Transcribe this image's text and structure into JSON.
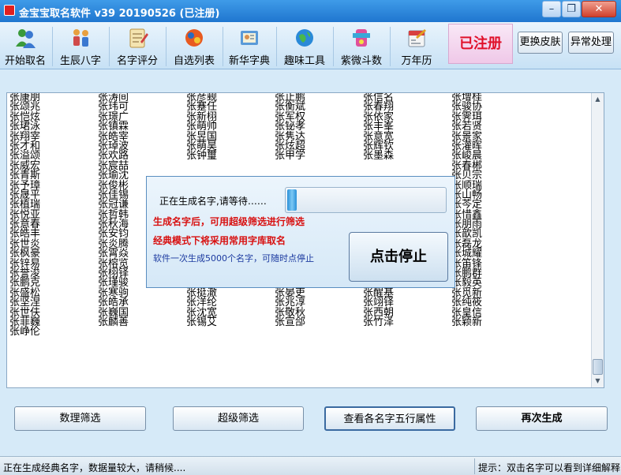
{
  "window": {
    "title": "金宝宝取名软件 v39 20190526 (已注册)",
    "minimize_glyph": "–",
    "restore_glyph": "❐",
    "close_glyph": "✕"
  },
  "toolbar": {
    "buttons": [
      {
        "label": "开始取名",
        "icon": "people-icon"
      },
      {
        "label": "生辰八字",
        "icon": "family-icon"
      },
      {
        "label": "名字评分",
        "icon": "notepad-icon"
      },
      {
        "label": "自选列表",
        "icon": "list-icon"
      },
      {
        "label": "新华字典",
        "icon": "dictionary-icon"
      },
      {
        "label": "趣味工具",
        "icon": "globe-icon"
      },
      {
        "label": "紫微斗数",
        "icon": "stars-icon"
      },
      {
        "label": "万年历",
        "icon": "calendar-icon"
      }
    ],
    "registered_label": "已注册",
    "skin_label": "更换皮肤",
    "exception_label": "异常处理"
  },
  "names": {
    "columns": [
      [
        "张康朋",
        "张颂兆",
        "张恺炫",
        "张珺泳",
        "张翔宰",
        "张才和",
        "张溢颂",
        "张威宏",
        "张青斯",
        "张予璋",
        "张晟平",
        "张植瑞",
        "张悦亚",
        "张意春",
        "张皓丰",
        "张世炎",
        "张枫豪",
        "张锌易",
        "张誉浚",
        "张鹏克",
        "张盛松",
        "张坚涅",
        "张世伕",
        "张菲巍",
        "张峥伦"
      ],
      [
        "张涛间",
        "张玮可",
        "张璟广",
        "张镇霖",
        "张皓宰",
        "张琸波",
        "张欢路",
        "张宸喆",
        "张瑜沈",
        "张俊彬",
        "张佳锡",
        "张冠谦",
        "张哲韩",
        "张秋海",
        "张安钧",
        "张炎腾",
        "张霄焱",
        "张榕览",
        "张栩铎",
        "张瑾骏",
        "张寒驹",
        "张皓承",
        "张巍国",
        "张麟善"
      ],
      [
        "张彦觋",
        "张蹇任",
        "张新栩",
        "张萌帅",
        "张昱国",
        "张萌昊",
        "张钟璽",
        "",
        "",
        "",
        "",
        "",
        "",
        "",
        "",
        "",
        "张猫峰",
        "张维军",
        "张景白",
        "张树禹",
        "张挺澈",
        "张洋纶",
        "张沈宽",
        "张锡艾"
      ],
      [
        "张止鹏",
        "张衡斌",
        "张军权",
        "张铋孝",
        "张隽达",
        "张炫超",
        "张甲学",
        "",
        "",
        "",
        "",
        "",
        "",
        "",
        "",
        "",
        "张桂阁",
        "张楠洁",
        "张坚任",
        "张才鹰",
        "张晏吏",
        "张兆淳",
        "张敬秋",
        "张宣郃"
      ],
      [
        "张信名",
        "张春翔",
        "张依家",
        "张丰峯",
        "张意宽",
        "张辉钦",
        "张墨森",
        "",
        "",
        "",
        "",
        "",
        "",
        "",
        "",
        "",
        "张诗宇",
        "张易朝",
        "张琸雄",
        "张仁家",
        "张醒基",
        "张翊铎",
        "张西朝",
        "张竹泽"
      ],
      [
        "张增桂",
        "张骏协",
        "张霁珥",
        "张若贤",
        "张景家",
        "张灌晖",
        "张峻晨",
        "张春郴",
        "张贝宗",
        "张顺瑞",
        "张山畅",
        "张芩定",
        "张惜鑫",
        "张朋雨",
        "张歆凯",
        "张磊龙",
        "张城耀",
        "张笛锋",
        "张鹏群",
        "张毅英",
        "张觅新",
        "张纯筱",
        "张皇信",
        "张颖新"
      ]
    ]
  },
  "dialog": {
    "status_text": "正在生成名字,请等待……",
    "progress": 0.06,
    "tip_filter": "生成名字后，可用超级筛选进行筛选",
    "tip_classic": "经典模式下将采用常用字库取名",
    "tip_batch": "软件一次生成5000个名字，可随时点停止",
    "stop_label": "点击停止"
  },
  "bottom_buttons": {
    "numerology": "数理筛选",
    "super_filter": "超级筛选",
    "five_elements": "查看各名字五行属性",
    "regenerate": "再次生成"
  },
  "statusbar": {
    "left": "正在生成经典名字，数据量较大，请稍候....",
    "right": "提示：双击名字可以看到详细解释"
  }
}
